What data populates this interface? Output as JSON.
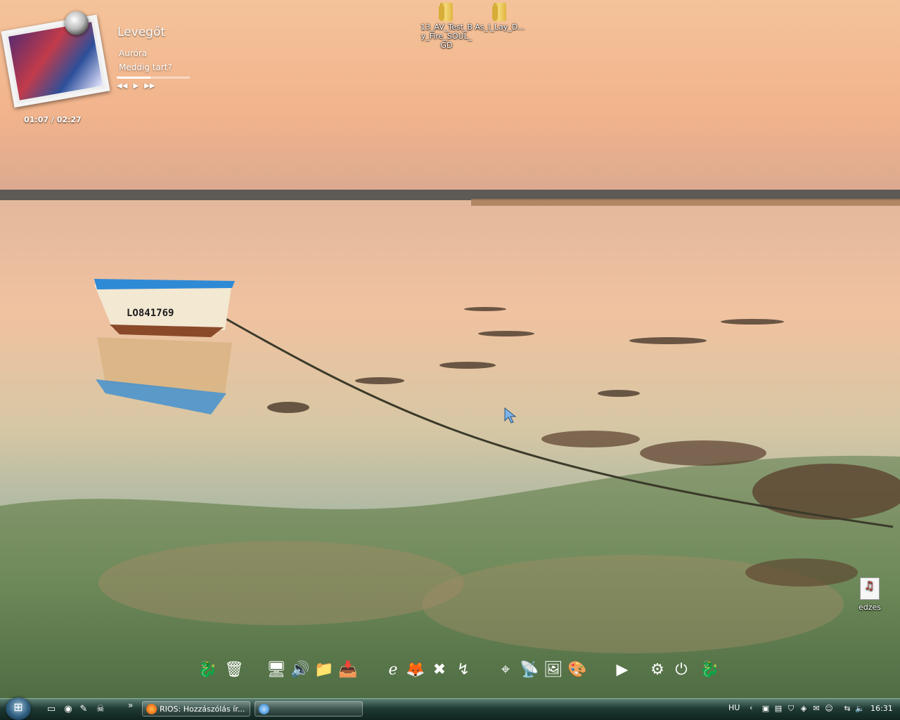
{
  "music_player": {
    "song_title": "Levegőt",
    "artist": "Auróra",
    "album": "Meddig tart?",
    "time": "01:07 / 02:27",
    "progress_fraction": 0.46,
    "controls": {
      "prev": "◀◀",
      "play": "▶",
      "next": "▶▶"
    },
    "album_art_icon": "album-cover-art"
  },
  "desktop_icons": [
    {
      "label": "13_AV_Test_B y_Fire_SOUL_ GD",
      "icon": "folder-icon"
    },
    {
      "label": "As_I_Lay_D...",
      "icon": "folder-icon"
    },
    {
      "label": "edzes",
      "icon": "playlist-file-icon"
    }
  ],
  "dock": {
    "items": [
      {
        "name": "dragon-icon",
        "glyph": "🐉"
      },
      {
        "name": "recycle-bin-icon",
        "glyph": "🗑"
      },
      {
        "name": "computer-icon",
        "glyph": "🖥"
      },
      {
        "name": "speaker-icon",
        "glyph": "🔊"
      },
      {
        "name": "folder-stack-icon",
        "glyph": "📁"
      },
      {
        "name": "download-folder-icon",
        "glyph": "📥"
      },
      {
        "name": "internet-explorer-icon",
        "glyph": "ℯ"
      },
      {
        "name": "firefox-icon",
        "glyph": "🦊"
      },
      {
        "name": "x-app-icon",
        "glyph": "✖"
      },
      {
        "name": "network-icon",
        "glyph": "↯"
      },
      {
        "name": "cursor-tool-icon",
        "glyph": "⌖"
      },
      {
        "name": "satellite-icon",
        "glyph": "📡"
      },
      {
        "name": "photo-viewer-icon",
        "glyph": "🖼"
      },
      {
        "name": "image-editor-icon",
        "glyph": "🎨"
      },
      {
        "name": "blue-arrow-icon",
        "glyph": "▶"
      },
      {
        "name": "gear-icon",
        "glyph": "⚙"
      },
      {
        "name": "power-icon",
        "glyph": "⏻"
      },
      {
        "name": "dragon2-icon",
        "glyph": "🐉"
      }
    ]
  },
  "taskbar": {
    "start_icon": "windows-logo-icon",
    "quick_launch": [
      {
        "name": "show-desktop-icon",
        "glyph": "▭"
      },
      {
        "name": "firefox-quicklaunch-icon",
        "glyph": "◉"
      },
      {
        "name": "notepad-quicklaunch-icon",
        "glyph": "✎"
      },
      {
        "name": "skull-quicklaunch-icon",
        "glyph": "☠"
      }
    ],
    "expand_label": "»",
    "tasks": [
      {
        "label": "RIOS: Hozzászólás ír...",
        "icon": "firefox-icon"
      },
      {
        "label": "",
        "icon": "app-icon"
      }
    ],
    "language": "HU",
    "tray_expand": "‹",
    "tray_icons": [
      {
        "name": "monitor-tray-icon",
        "glyph": "▣"
      },
      {
        "name": "graph-tray-icon",
        "glyph": "▤"
      },
      {
        "name": "shield-tray-icon",
        "glyph": "⛉"
      },
      {
        "name": "antivirus-tray-icon",
        "glyph": "◈"
      },
      {
        "name": "mail-tray-icon",
        "glyph": "✉"
      },
      {
        "name": "user-tray-icon",
        "glyph": "☺"
      },
      {
        "name": "network-tray-icon",
        "glyph": "⇆"
      },
      {
        "name": "volume-tray-icon",
        "glyph": "🔈"
      }
    ],
    "clock": "16:31"
  }
}
